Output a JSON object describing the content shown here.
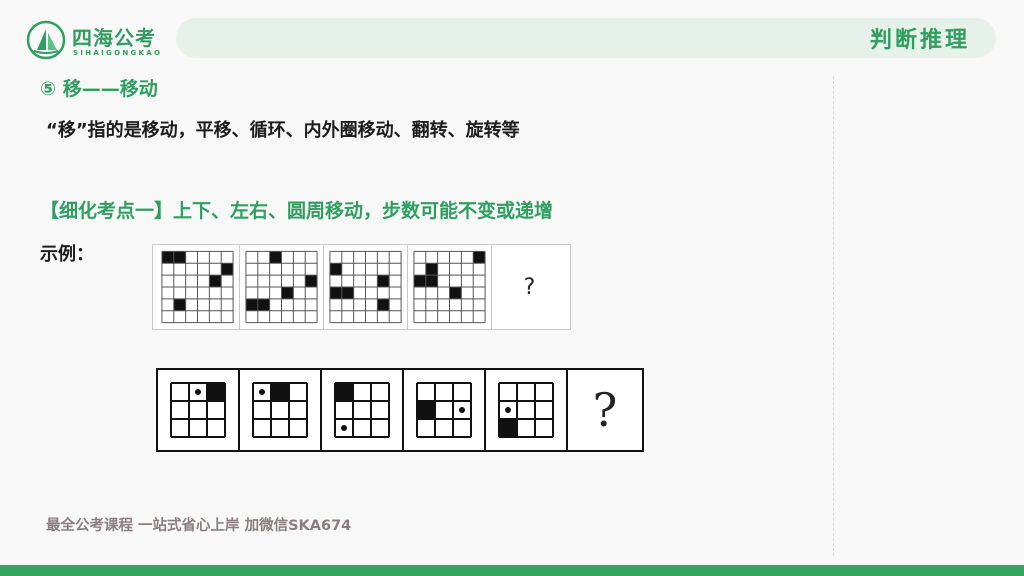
{
  "brand": {
    "name": "四海公考",
    "subtitle": "SIHAIGONGKAO",
    "logo_icon": "sail-mountain-logo-icon"
  },
  "header": {
    "section_title": "判断推理"
  },
  "content": {
    "heading": "⑤ 移——移动",
    "description": "“移”指的是移动，平移、循环、内外圈移动、翻转、旋转等",
    "subheading": "【细化考点一】上下、左右、圆周移动，步数可能不变或递增",
    "example_label": "示例："
  },
  "puzzle1": {
    "grid_size": 6,
    "question_mark": "?",
    "panels": [
      {
        "black": [
          [
            0,
            0
          ],
          [
            0,
            1
          ],
          [
            1,
            5
          ],
          [
            2,
            4
          ],
          [
            4,
            1
          ]
        ]
      },
      {
        "black": [
          [
            0,
            2
          ],
          [
            2,
            5
          ],
          [
            3,
            3
          ],
          [
            4,
            0
          ],
          [
            4,
            1
          ]
        ]
      },
      {
        "black": [
          [
            1,
            0
          ],
          [
            2,
            4
          ],
          [
            3,
            0
          ],
          [
            3,
            1
          ],
          [
            4,
            4
          ]
        ]
      },
      {
        "black": [
          [
            0,
            5
          ],
          [
            1,
            1
          ],
          [
            2,
            0
          ],
          [
            2,
            1
          ],
          [
            3,
            3
          ]
        ]
      }
    ]
  },
  "puzzle2": {
    "grid_size": 3,
    "question_mark": "?",
    "panels": [
      {
        "black": [
          0,
          2
        ],
        "dot": [
          0,
          1
        ]
      },
      {
        "black": [
          0,
          1
        ],
        "dot": [
          0,
          0
        ]
      },
      {
        "black": [
          0,
          0
        ],
        "dot": [
          2,
          0
        ]
      },
      {
        "black": [
          1,
          0
        ],
        "dot": [
          1,
          2
        ]
      },
      {
        "black": [
          2,
          0
        ],
        "dot": [
          1,
          0
        ]
      }
    ]
  },
  "footer": {
    "text": "最全公考课程 一站式省心上岸 加微信SKA674"
  },
  "colors": {
    "accent": "#2f9e5f",
    "header_bar": "#e6f1ea",
    "footer_text": "#8a7e7e",
    "bottom_bar": "#34a362"
  }
}
